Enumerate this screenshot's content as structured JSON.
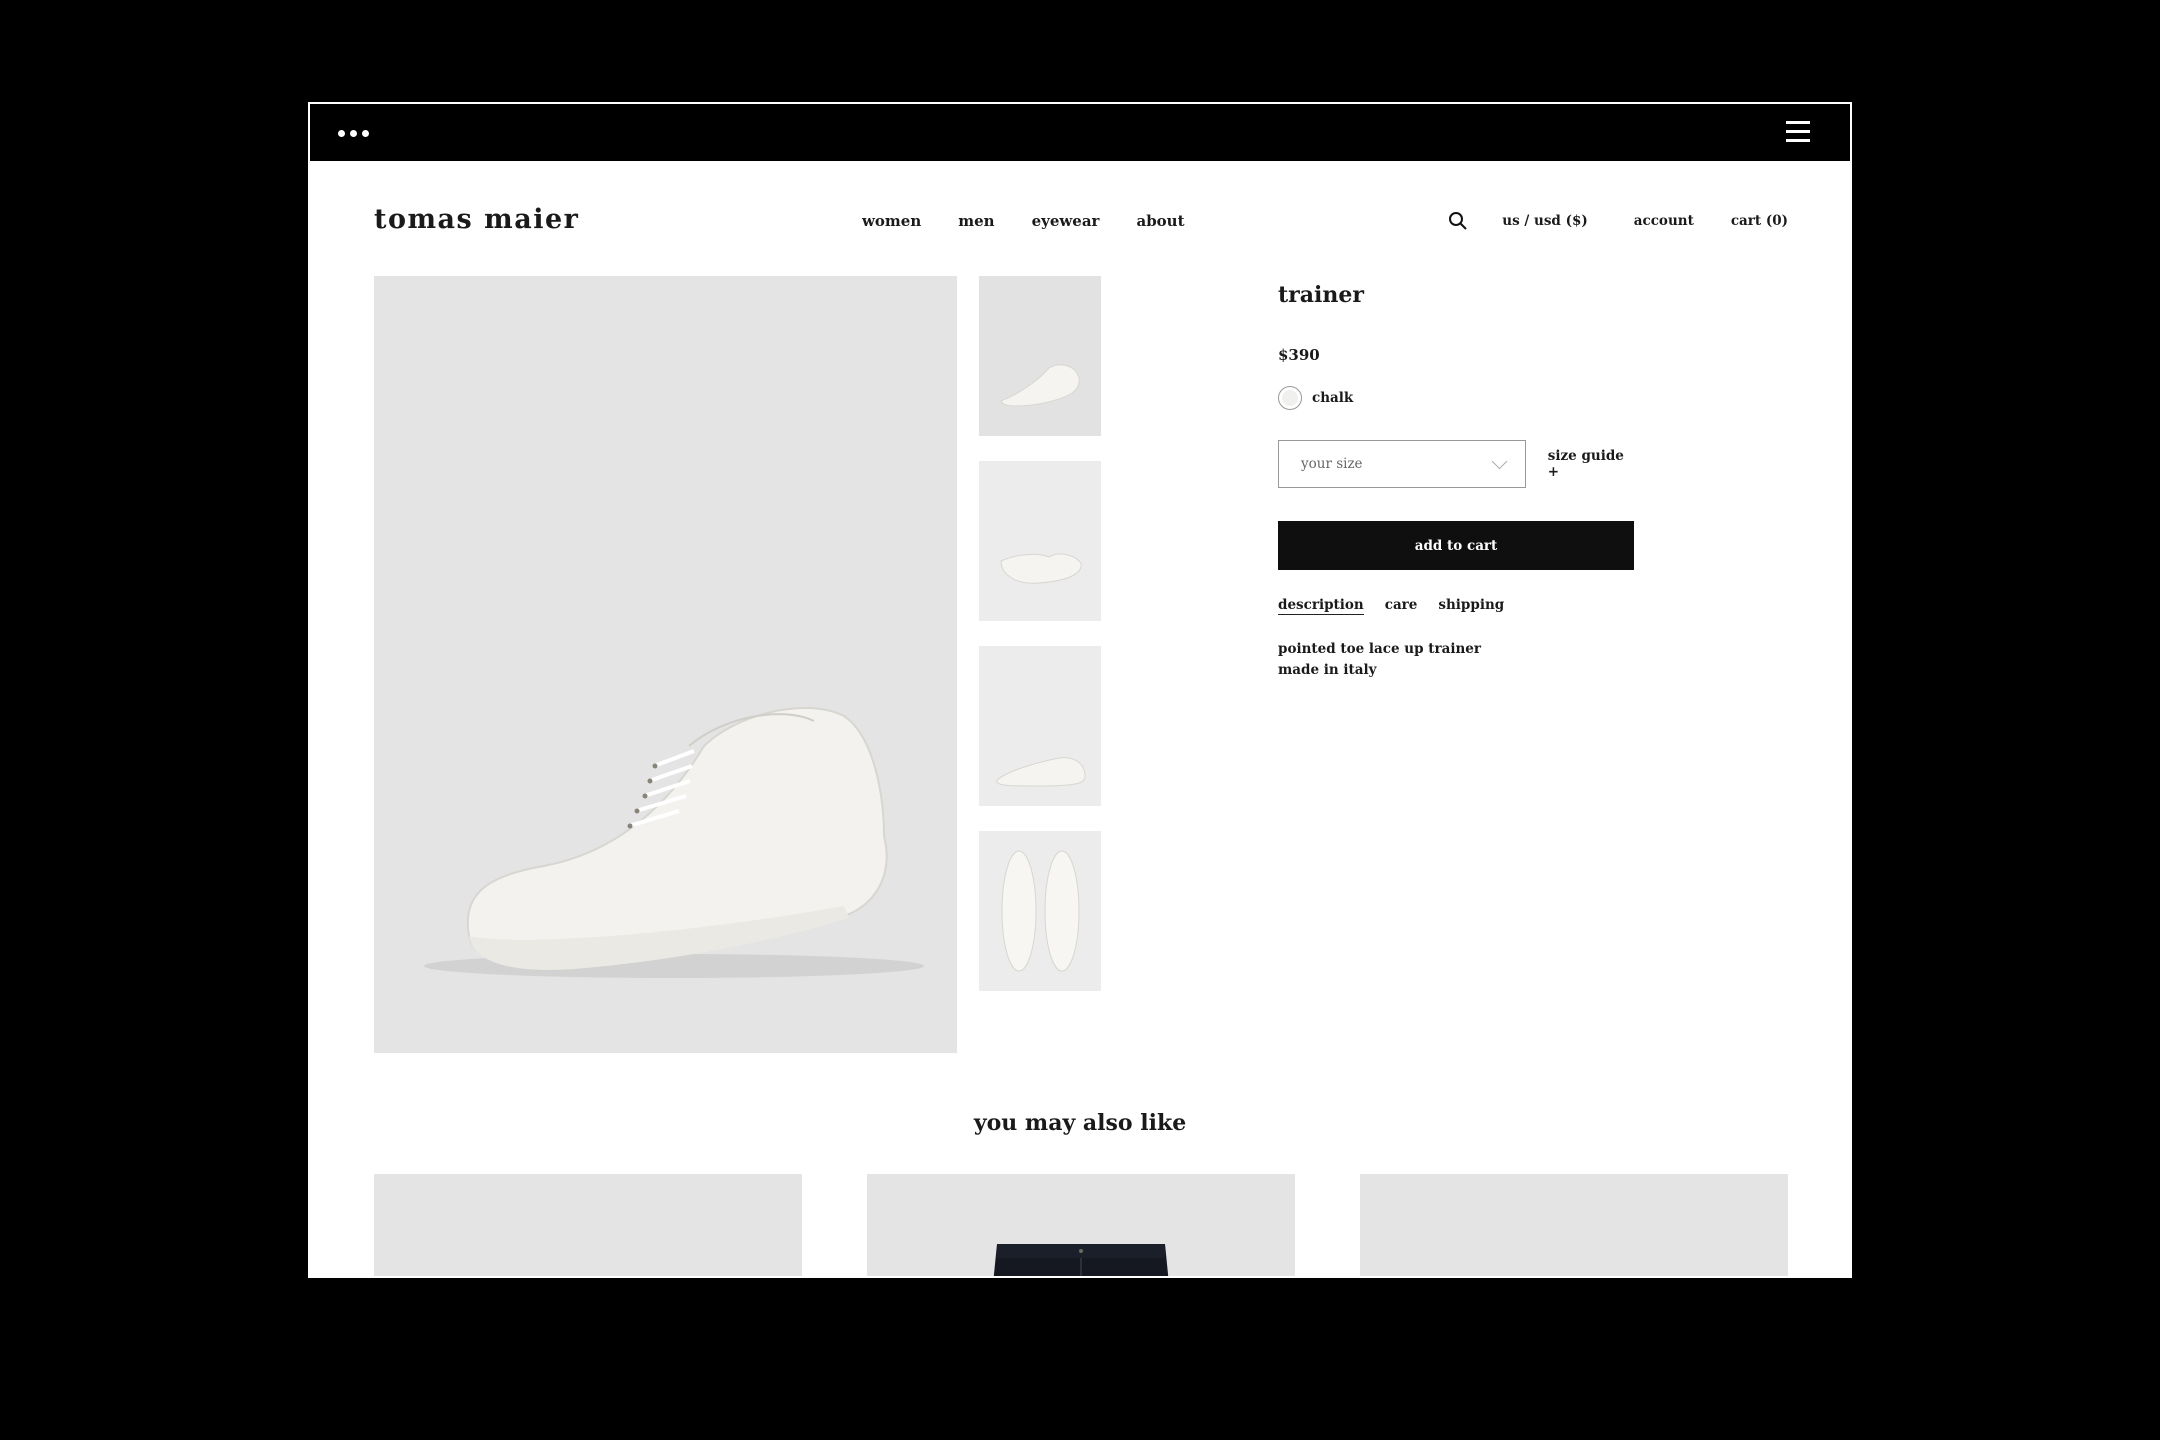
{
  "nav": {
    "logo": "tomas maier",
    "links": [
      "women",
      "men",
      "eyewear",
      "about"
    ],
    "region": "us / usd ($)",
    "account": "account",
    "cart": "cart (0)"
  },
  "product": {
    "title": "trainer",
    "price": "$390",
    "color": "chalk",
    "size_placeholder": "your size",
    "size_guide": "size guide +",
    "add_to_cart": "add to cart",
    "tabs": [
      "description",
      "care",
      "shipping"
    ],
    "description_lines": [
      "pointed toe lace up trainer",
      "made in italy"
    ]
  },
  "recommendations": {
    "title": "you may also like"
  },
  "icons": {
    "menu": "dots-icon",
    "hamburger": "hamburger-icon",
    "search": "search-icon",
    "chevron": "chevron-down-icon"
  },
  "colors": {
    "frame": "#000000",
    "image_bg": "#e4e4e5",
    "button": "#0f0f0f"
  }
}
